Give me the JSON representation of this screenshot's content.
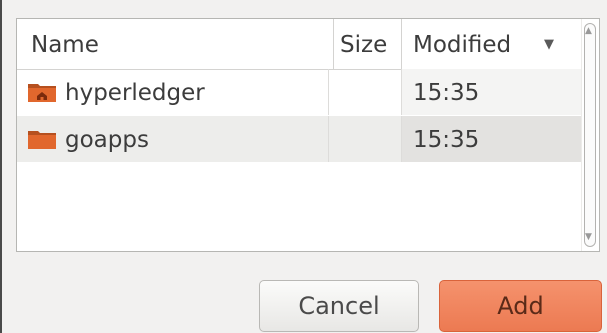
{
  "columns": {
    "name": "Name",
    "size": "Size",
    "modified": "Modified",
    "sort_icon": "sort-descending-icon"
  },
  "files": [
    {
      "name": "hyperledger",
      "size": "",
      "modified": "15:35",
      "icon": "folder-home-icon"
    },
    {
      "name": "goapps",
      "size": "",
      "modified": "15:35",
      "icon": "folder-icon"
    }
  ],
  "buttons": {
    "cancel": "Cancel",
    "add": "Add"
  },
  "colors": {
    "accent": "#ec7a52",
    "folder": "#e1672d",
    "selected_row": "#ededeb"
  }
}
